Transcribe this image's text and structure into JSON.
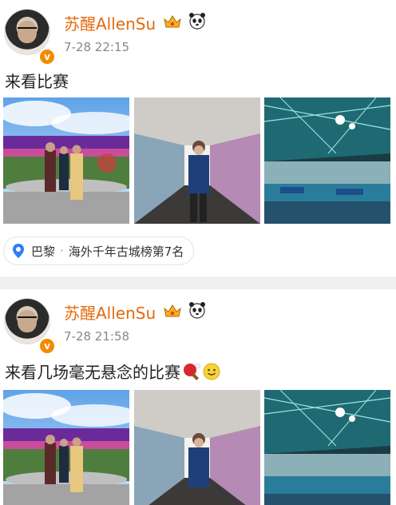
{
  "posts": [
    {
      "author": "苏醒AllenSu",
      "verified_mark": "v",
      "time": "7-28 22:15",
      "text": "来看比赛",
      "emojis": [],
      "location": {
        "city": "巴黎",
        "separator": "·",
        "detail": "海外千年古城榜第7名"
      }
    },
    {
      "author": "苏醒AllenSu",
      "verified_mark": "v",
      "time": "7-28 21:58",
      "text": "来看几场毫无悬念的比赛",
      "emojis": [
        "ping-pong-emoji",
        "smile-emoji"
      ]
    }
  ],
  "icons": {
    "crown": "crown-badge-icon",
    "panda": "panda-badge-icon",
    "location": "location-pin-icon"
  },
  "colors": {
    "name": "#e56a0b",
    "time": "#888888",
    "verified": "#f48a00",
    "location_pin": "#2f7cf6"
  }
}
